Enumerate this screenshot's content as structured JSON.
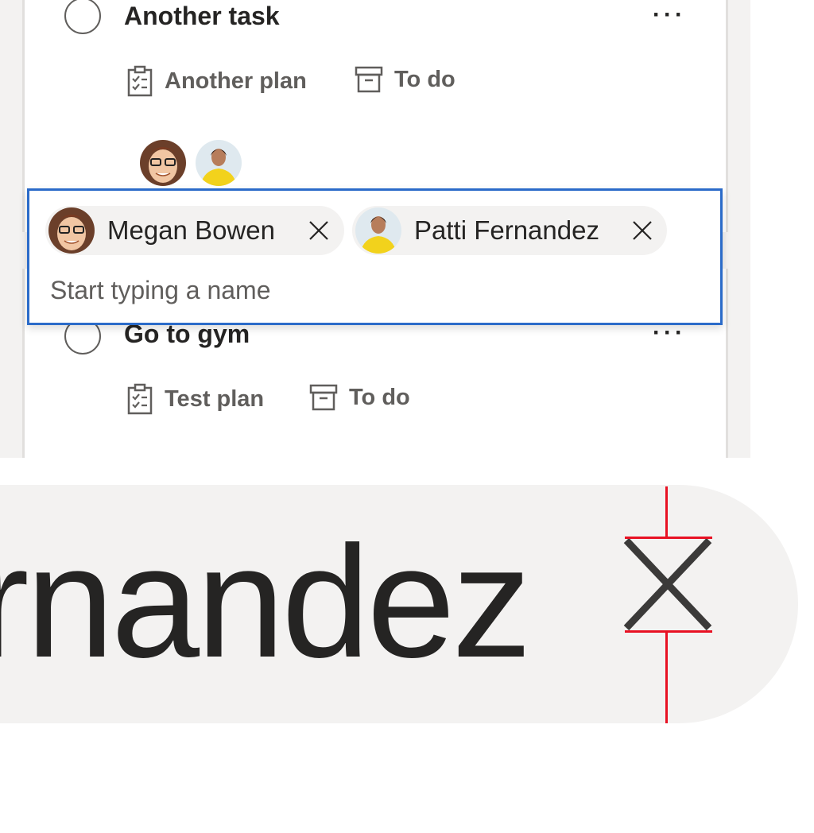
{
  "tasks": [
    {
      "title": "Another task",
      "plan": "Another plan",
      "bucket": "To do",
      "assignees": [
        "megan-bowen-avatar",
        "patti-fernandez-avatar"
      ]
    },
    {
      "title": "Go to gym",
      "plan": "Test plan",
      "bucket": "To do"
    }
  ],
  "people_picker": {
    "chips": [
      {
        "name": "Megan Bowen"
      },
      {
        "name": "Patti Fernandez"
      }
    ],
    "placeholder": "Start typing a name"
  },
  "zoom": {
    "text": "rnandez"
  },
  "icons": {
    "more": "more-icon",
    "plan": "clipboard-checklist-icon",
    "bucket": "archive-box-icon",
    "remove": "close-icon"
  },
  "colors": {
    "focus_border": "#2b6bc9",
    "chip_background": "#f3f2f1",
    "measure_line": "#e81123"
  }
}
